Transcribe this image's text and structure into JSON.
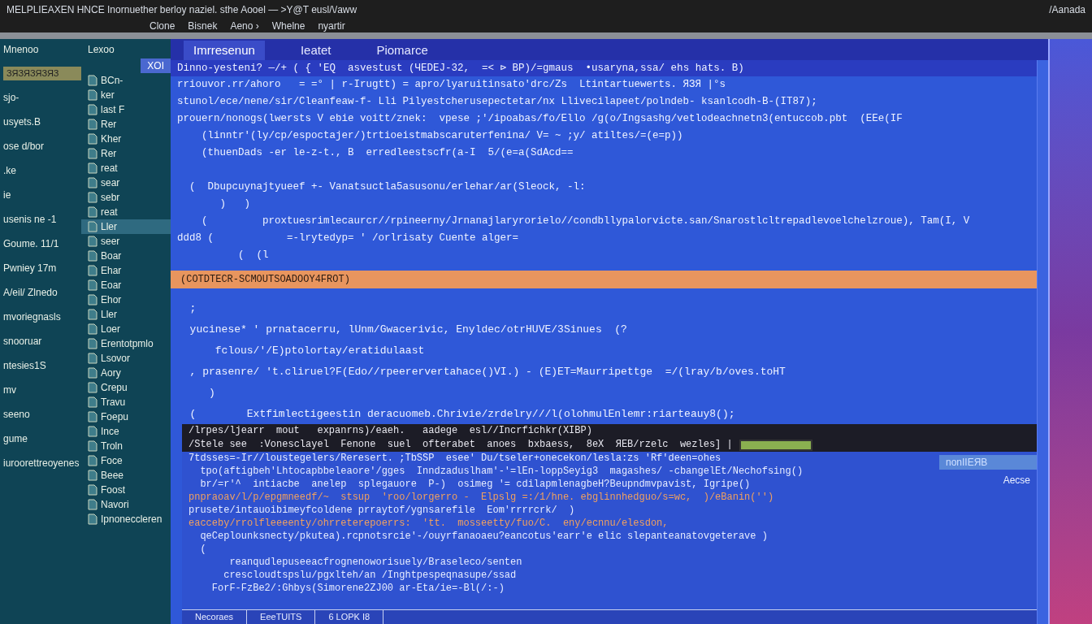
{
  "title_bar": {
    "title": "MELPLIEAXEN HNCE  Inornuether  berloy naziel. sthe Aooel — >Y@T  eusl/\\/aww",
    "right": "/Aanada"
  },
  "menu": [
    "Clone",
    "Bisnek",
    "Aeno ›",
    "Whelne",
    "nyartir"
  ],
  "sidebar": {
    "header": "Mnenoo",
    "header_2": "Lexoo",
    "highlight": "ЗЯЗЯЗЯЗЯЗ",
    "badge": "XOI",
    "notes": [
      "sjo-",
      "usyets.B",
      "ose d/bor",
      ".ke",
      "ie",
      "usenis ne -1",
      "Goume. 11/1",
      "Pwniey 17m",
      "A/eil/ Zlnedo",
      "mvoriegnasls",
      "snooruar",
      "ntesies1S",
      "mv",
      "seeno",
      "gume",
      "iuroorettreoyenes"
    ],
    "files": [
      {
        "label": "BCn-",
        "selected": false
      },
      {
        "label": "ker",
        "selected": false
      },
      {
        "label": "last F",
        "selected": false
      },
      {
        "label": "Rer",
        "selected": false
      },
      {
        "label": "Kher",
        "selected": false
      },
      {
        "label": "Rer",
        "selected": false
      },
      {
        "label": "reat",
        "selected": false
      },
      {
        "label": "sear",
        "selected": false
      },
      {
        "label": "sebr",
        "selected": false
      },
      {
        "label": "reat",
        "selected": false
      },
      {
        "label": "Ller",
        "selected": true
      },
      {
        "label": "seer",
        "selected": false
      },
      {
        "label": "Boar",
        "selected": false
      },
      {
        "label": "Ehar",
        "selected": false
      },
      {
        "label": "Eoar",
        "selected": false
      },
      {
        "label": "Ehor",
        "selected": false
      },
      {
        "label": "Ller",
        "selected": false
      },
      {
        "label": "Loer",
        "selected": false
      },
      {
        "label": "Erentotpmlo",
        "selected": false
      },
      {
        "label": "Lsovor",
        "selected": false
      },
      {
        "label": "Aory",
        "selected": false
      },
      {
        "label": "Crepu",
        "selected": false
      },
      {
        "label": "Travu",
        "selected": false
      },
      {
        "label": "Foepu",
        "selected": false
      },
      {
        "label": "Ince",
        "selected": false
      },
      {
        "label": "Troln",
        "selected": false
      },
      {
        "label": "Foce",
        "selected": false
      },
      {
        "label": "Beee",
        "selected": false
      },
      {
        "label": "Foost",
        "selected": false
      },
      {
        "label": "Navori",
        "selected": false
      },
      {
        "label": "Ipnoneccleren",
        "selected": false
      }
    ]
  },
  "tabs": [
    {
      "label": "Imrresenun",
      "selected": true
    },
    {
      "label": "Ieatet",
      "selected": false
    },
    {
      "label": "Piomarce",
      "selected": false
    }
  ],
  "editor": {
    "header_line": "Dinno-yesteni? —/+ ( { 'EQ  asvestust (ЧEDEJ-32,  =< ⊳ BP)/=gmaus  •usaryna,ssa/ ehs hats. B)",
    "lines": [
      "rriouvor.rr/ahoro   = =° | r-Irugtt) = apro/lyaruitinsato'drc/Zs  Ltintartuewerts. ЯЗЯ |°s",
      "stunol/ece/nene/sir/Cleanfeaw-f- Lli Pilyestcherusepectetar/nx Llivecilapeet/polndeb- ksanlcodh-B-(IT87);",
      "prouern/nonogs(lwersts V ebie voitt/znek:  vpese ;'/ipoabas/fo/Ello /g(o/Ingsashg/vetlodeachnetn3(entuccob.pbt  (EEe(IF",
      "    (linntr'(ly/cp/espoctajer/)trtioeistmabscaruterfenina/ V= ~ ;y/ atiltes/=(e=p))",
      "    (thuenDads -er le-z-t., B  erredleestscfr(a-I  5/(e=a(SdAcd==",
      "  (  Dbupcuynajtyueef +- Vanatsuctla5asusonu/erlehar/ar(Sleock, -l:",
      "       )   )",
      "    (         proxtuesrimlecaurcr//rpineerny/Jrnanajlaryrorielo//condbllypalorvicte.san/Snarostlcltrepadlevoelchelzroue), Tam(I, V",
      "ddd8 (            =-lrytedyp= ' /orlrisaty Cuente alger=",
      "          (  (l"
    ],
    "divider": "(COTDTECR-SCMOUTSOADOOY4FROT)",
    "lower_lines": [
      "  ;",
      "  yucinese* ' prnatacerru, lUnm/Gwacerivic, Enyldec/otrHUVE/3Sinues  (?",
      "      fclous/'/E)ptolortay/eratidulaast",
      "  , prasenre/ 't.cliruel?F(Edo//rpeerervertahace()VI.) - (E)ET=Maurripettge  =/(lray/b/oves.toHT",
      "     )",
      "  (        Extfimlectigeestin deracuomeb.Chrivie/zrdelry///l(olohmulEnlemr:riarteauy8();"
    ]
  },
  "panel": {
    "header_lines": [
      "/lrpes/ljearr  mout   expanrns)/eaeh.   aadege  esl//Incrfichkr(XIBP)",
      "/Stele see  ׃ Vonesclayel  Fenone  suel  ofterabet  anoes  bxbaess,  8eX  ЯEB/rzelc  wezles] |"
    ],
    "progress": {
      "level": 1
    },
    "side_labels": [
      "nonIIEЯB",
      "Aecse"
    ],
    "lines": [
      {
        "text": "7tdsses=-Ir//loustegelers/Reresert. ;TbSSP  esee' Du/tseler+onecekon/lesla:zs 'Rf'deen=ohes",
        "kind": "code"
      },
      {
        "text": "  tpo(aftigbeh'Lhtocapbbeleaore'/gges  Inndzaduslham'-'=lEn-loppSeyig3  magashes/ -cbangelEt/Nechofsing()",
        "kind": "code"
      },
      {
        "text": "  br/=r'^  intiacbe  anelep  splegauore  P-)  osimeg '= cdilapmlenagbeH?Beupndmvpavist, Igripe()",
        "kind": "code"
      },
      {
        "text": "pnpraoav/l/p/epgmneedf/~  stsup  'roo/lorgerro -  Elpslg =:/1/hne. ebglinnhedguo/s=wc,  )/eBanin('')",
        "kind": "accent"
      },
      {
        "text": "prusete/intauoibimeyfcoldene prraytof/ygnsarefile  Eom'rrrrcrk/  )",
        "kind": "code"
      },
      {
        "text": "eacceby/rrolfleeeenty/ohrreterepoerrs:  'tt.  mosseetty/fuo/C.  eny/ecnnu/elesdon,",
        "kind": "accent"
      },
      {
        "text": "  qeCeplounksnecty/pkutea).rcpnotsrcie'-/ouyrfanaoaeu?eancotus'earr'e elic slepanteanatovgeterave )",
        "kind": "code"
      },
      {
        "text": "  (",
        "kind": "code"
      },
      {
        "text": "       reanqudlepuseeacfrognenoworisuely/Braseleco/senten",
        "kind": "code"
      },
      {
        "text": "      crescloudtspslu/pgxlteh/an /Inghtpespeqnasupe/ssad",
        "kind": "code"
      },
      {
        "text": "    ForF-FzBe2/:Ghbys(Simorene2ZJ00 ar-Eta/ie=-Bl(/:-)",
        "kind": "code"
      }
    ]
  },
  "status_bar": [
    "Necoraes",
    "EeeTUITS",
    "6  LOPK  I8"
  ]
}
